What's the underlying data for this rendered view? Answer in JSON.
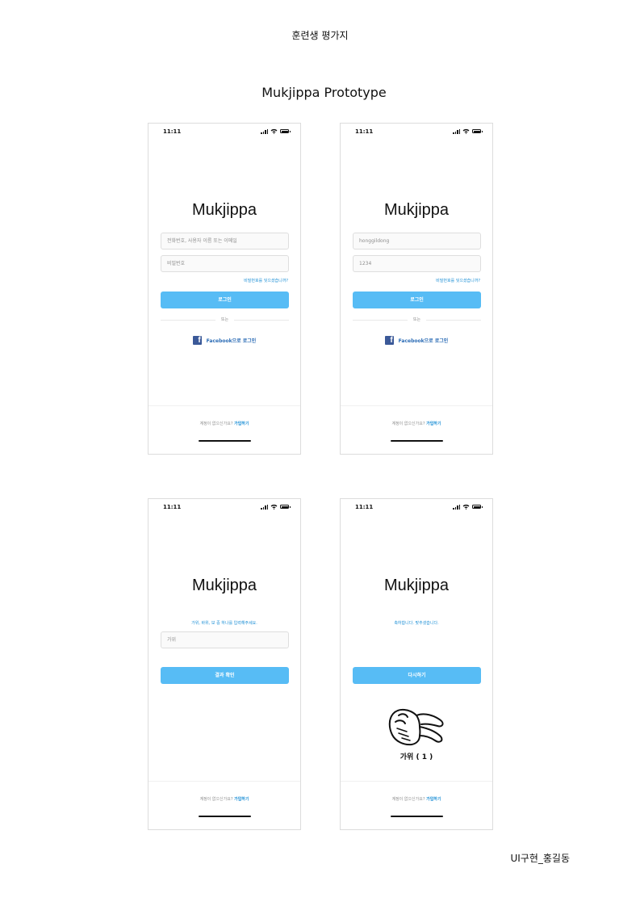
{
  "document": {
    "header": "훈련생 평가지",
    "title": "Mukjippa Prototype",
    "footer": "UI구현_홍길동"
  },
  "status_bar": {
    "time": "11:11"
  },
  "app": {
    "logo": "Mukjippa",
    "forgot_password": "비밀번호를 잊으셨습니까?",
    "login_button": "로그인",
    "or_divider": "또는",
    "facebook_login": "Facebook으로 로그인",
    "no_account": "계정이 없으신가요?",
    "signup": "가입하기"
  },
  "screens": {
    "login_empty": {
      "id_placeholder": "전화번호, 사용자 이름 또는 이메일",
      "password_placeholder": "비밀번호"
    },
    "login_filled": {
      "id_value": "honggildong",
      "password_value": "1234"
    },
    "game_input": {
      "prompt": "가위, 바위, 보 중 하나를 입력해주세요.",
      "input_value": "가위",
      "button": "결과 확인"
    },
    "game_result": {
      "message": "축하합니다. 맞추셨습니다.",
      "button": "다시하기",
      "hand_icon": "scissors-hand-icon",
      "result": "가위 ( 1 )"
    }
  },
  "colors": {
    "primary_button": "#57bcf5",
    "link": "#1e90d6",
    "facebook": "#3b5998"
  }
}
